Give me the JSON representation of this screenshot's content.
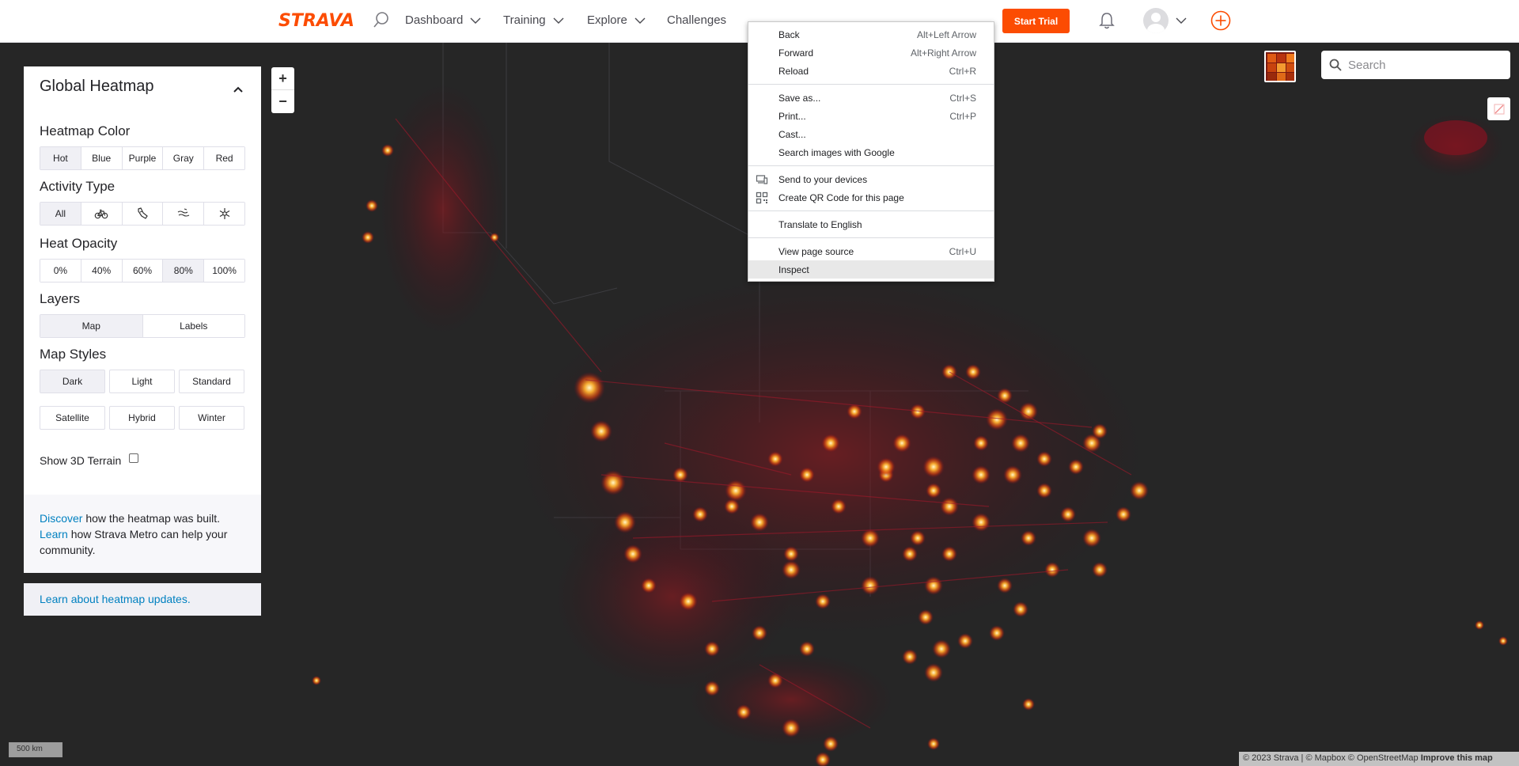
{
  "nav": {
    "logo": "STRAVA",
    "items": [
      {
        "label": "Dashboard",
        "has_chevron": true
      },
      {
        "label": "Training",
        "has_chevron": true
      },
      {
        "label": "Explore",
        "has_chevron": true
      },
      {
        "label": "Challenges",
        "has_chevron": false
      }
    ],
    "start_trial": "Start Trial",
    "accent": "#fc4c02"
  },
  "panel": {
    "title": "Global Heatmap",
    "heatmap_color": {
      "title": "Heatmap Color",
      "options": [
        "Hot",
        "Blue",
        "Purple",
        "Gray",
        "Red"
      ],
      "selected": "Hot"
    },
    "activity_type": {
      "title": "Activity Type",
      "options": [
        "All",
        "bike-icon",
        "shoe-icon",
        "water-icon",
        "snowflake-icon"
      ],
      "selected": "All"
    },
    "heat_opacity": {
      "title": "Heat Opacity",
      "options": [
        "0%",
        "40%",
        "60%",
        "80%",
        "100%"
      ],
      "selected": "80%"
    },
    "layers": {
      "title": "Layers",
      "options": [
        "Map",
        "Labels"
      ],
      "selected": "Map"
    },
    "map_styles": {
      "title": "Map Styles",
      "options": [
        "Dark",
        "Light",
        "Standard",
        "Satellite",
        "Hybrid",
        "Winter"
      ],
      "selected": "Dark"
    },
    "terrain_label": "Show 3D Terrain",
    "terrain_checked": false,
    "footer": {
      "discover_link": "Discover",
      "discover_text": " how the heatmap was built.",
      "learn_link": "Learn",
      "learn_text": " how Strava Metro can help your community."
    },
    "updates_link": "Learn about heatmap updates."
  },
  "map": {
    "zoom_in": "+",
    "zoom_out": "−",
    "search_placeholder": "Search",
    "scale": "500 km",
    "attribution": "© 2023 Strava | © Mapbox © OpenStreetMap",
    "improve": "Improve this map"
  },
  "context_menu": {
    "groups": [
      [
        {
          "label": "Back",
          "shortcut": "Alt+Left Arrow"
        },
        {
          "label": "Forward",
          "shortcut": "Alt+Right Arrow"
        },
        {
          "label": "Reload",
          "shortcut": "Ctrl+R"
        }
      ],
      [
        {
          "label": "Save as...",
          "shortcut": "Ctrl+S"
        },
        {
          "label": "Print...",
          "shortcut": "Ctrl+P"
        },
        {
          "label": "Cast...",
          "shortcut": ""
        },
        {
          "label": "Search images with Google",
          "shortcut": ""
        }
      ],
      [
        {
          "label": "Send to your devices",
          "shortcut": "",
          "icon": "devices-icon"
        },
        {
          "label": "Create QR Code for this page",
          "shortcut": "",
          "icon": "qr-code-icon"
        }
      ],
      [
        {
          "label": "Translate to English",
          "shortcut": ""
        }
      ],
      [
        {
          "label": "View page source",
          "shortcut": "Ctrl+U"
        },
        {
          "label": "Inspect",
          "shortcut": "",
          "highlighted": true
        }
      ]
    ]
  }
}
